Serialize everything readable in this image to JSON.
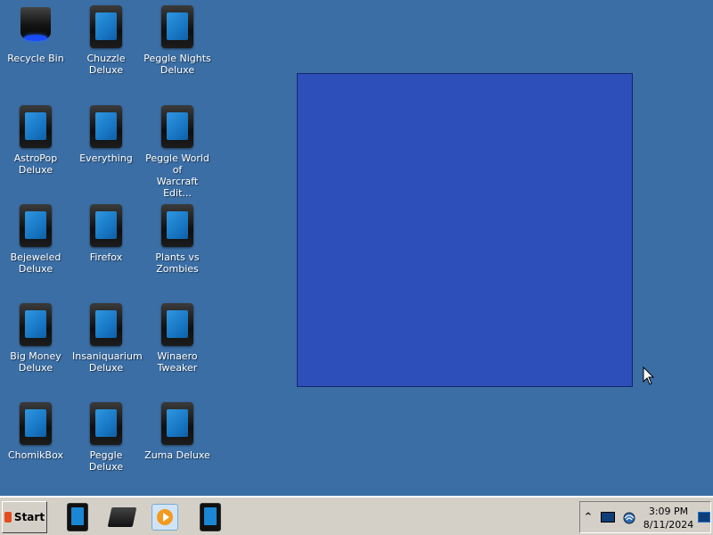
{
  "desktop": {
    "background_color": "#3a6ea5",
    "icons": [
      {
        "label": "Recycle Bin",
        "icon": "recycle-bin-icon"
      },
      {
        "label": "Chuzzle Deluxe",
        "icon": "app-tablet-icon"
      },
      {
        "label": "Peggle Nights\nDeluxe",
        "icon": "app-tablet-icon"
      },
      {
        "label": "AstroPop\nDeluxe",
        "icon": "app-tablet-icon"
      },
      {
        "label": "Everything",
        "icon": "app-tablet-icon"
      },
      {
        "label": "Peggle World of\nWarcraft Edit...",
        "icon": "app-tablet-icon"
      },
      {
        "label": "Bejeweled\nDeluxe",
        "icon": "app-tablet-icon"
      },
      {
        "label": "Firefox",
        "icon": "app-tablet-icon"
      },
      {
        "label": "Plants vs\nZombies",
        "icon": "app-tablet-icon"
      },
      {
        "label": "Big Money\nDeluxe",
        "icon": "app-tablet-icon"
      },
      {
        "label": "Insaniquarium\nDeluxe",
        "icon": "app-tablet-icon"
      },
      {
        "label": "Winaero\nTweaker",
        "icon": "app-tablet-icon"
      },
      {
        "label": "ChomikBox",
        "icon": "app-tablet-icon"
      },
      {
        "label": "Peggle Deluxe",
        "icon": "app-tablet-icon"
      },
      {
        "label": "Zuma Deluxe",
        "icon": "app-tablet-icon"
      }
    ]
  },
  "window": {
    "color": "#2d4fba"
  },
  "taskbar": {
    "start_label": "Start",
    "quick_launch": [
      {
        "icon": "app-tablet-icon"
      },
      {
        "icon": "hard-drive-icon"
      },
      {
        "icon": "media-player-icon"
      },
      {
        "icon": "app-tablet-icon"
      }
    ],
    "tray": {
      "icons": [
        "show-hidden-chevron-icon",
        "monitor-icon",
        "network-icon",
        "show-desktop-icon"
      ],
      "time": "3:09 PM",
      "date": "8/11/2024"
    }
  }
}
